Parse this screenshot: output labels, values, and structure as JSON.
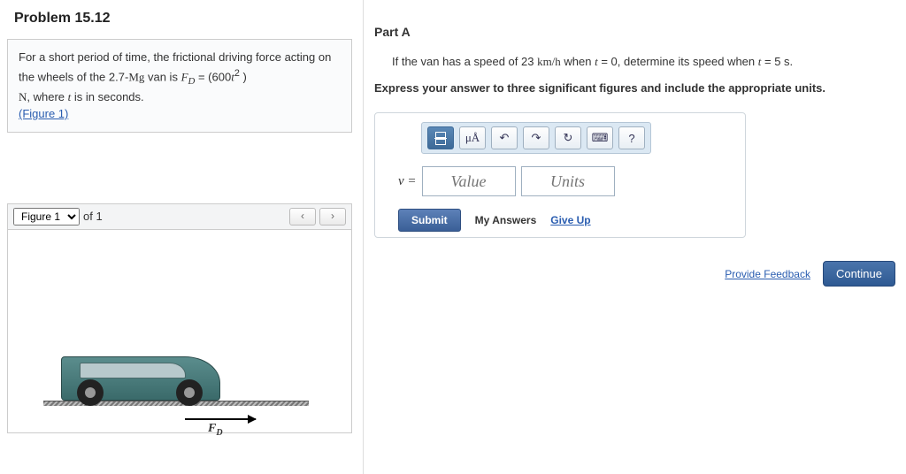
{
  "problem": {
    "title": "Problem 15.12",
    "desc_prefix": "For a short period of time, the frictional driving force acting on the wheels of the 2.7-",
    "mg": "Mg",
    "desc_mid": " van is ",
    "fd_var": "F",
    "fd_sub": "D",
    "eq_mid": " = (600",
    "t_var": "t",
    "sq": "2",
    "eq_end": " )",
    "line2_pre": "N",
    "line2_rest": ", where ",
    "line2_var": "t",
    "line2_end": " is in seconds.",
    "figure_link": "(Figure 1)"
  },
  "figure": {
    "label": "Figure 1",
    "of": "of 1",
    "prev": "‹",
    "next": "›",
    "fd_label": "F",
    "fd_sub": "D"
  },
  "partA": {
    "heading": "Part A",
    "q_pre": "If the van has a speed of 23 ",
    "q_unit": "km/h",
    "q_mid": " when ",
    "q_t": "t",
    "q_eq0": " = 0, determine its speed when ",
    "q_t2": "t",
    "q_eq5": " = 5 s.",
    "instruction": "Express your answer to three significant figures and include the appropriate units."
  },
  "toolbar": {
    "mu": "μÅ",
    "undo": "↶",
    "redo": "↷",
    "reset": "↻",
    "kb": "⌨",
    "help": "?"
  },
  "answer": {
    "var": "v = ",
    "value_ph": "Value",
    "units_ph": "Units",
    "submit": "Submit",
    "myanswers": "My Answers",
    "giveup": "Give Up"
  },
  "footer": {
    "feedback": "Provide Feedback",
    "continue": "Continue"
  }
}
